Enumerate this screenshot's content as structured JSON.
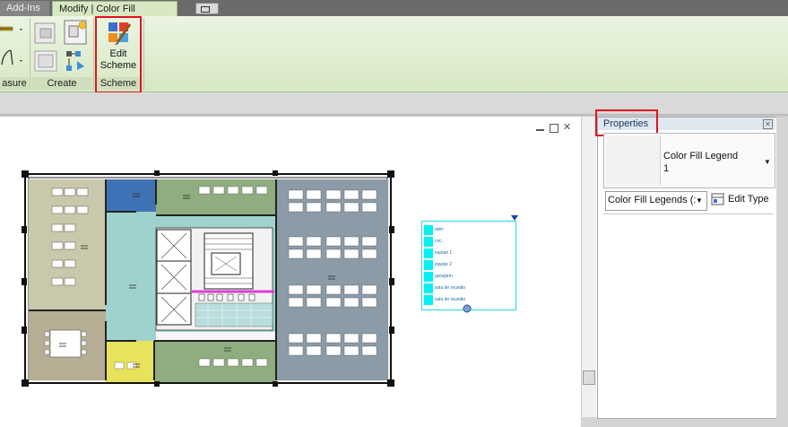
{
  "ribbon": {
    "tabs": [
      {
        "label": "Add-Ins",
        "active": false
      },
      {
        "label": "Modify | Color Fill Legends",
        "active": true
      }
    ],
    "toggle_label": "▾",
    "panels": {
      "measure": {
        "label": "asure"
      },
      "create": {
        "label": "Create"
      },
      "scheme": {
        "label": "Scheme",
        "edit_button_line1": "Edit",
        "edit_button_line2": "Scheme"
      }
    }
  },
  "properties": {
    "title": "Properties",
    "type_name": "Color Fill Legend",
    "type_number": "1",
    "selector_value": "Color Fill Legends (:",
    "edit_type_label": "Edit Type"
  },
  "legend": {
    "entries": [
      "adm",
      "circ.",
      "equipe 1",
      "equipe 2",
      "garagem",
      "sala de reunião",
      "sala de reunião"
    ],
    "swatch_color": "#00f2f2"
  },
  "colors": {
    "accent": "#e0131f",
    "ribbon": "#dcebcb",
    "legend_cyan": "#00f2f2",
    "room_olive": "#c9c8aa",
    "room_blue": "#8c9ba8",
    "room_teal": "#9fd2cf",
    "room_green": "#8fad7f",
    "room_darkblue": "#3f72b4",
    "room_yellow": "#e7e35a",
    "room_tan": "#b6ae94"
  }
}
